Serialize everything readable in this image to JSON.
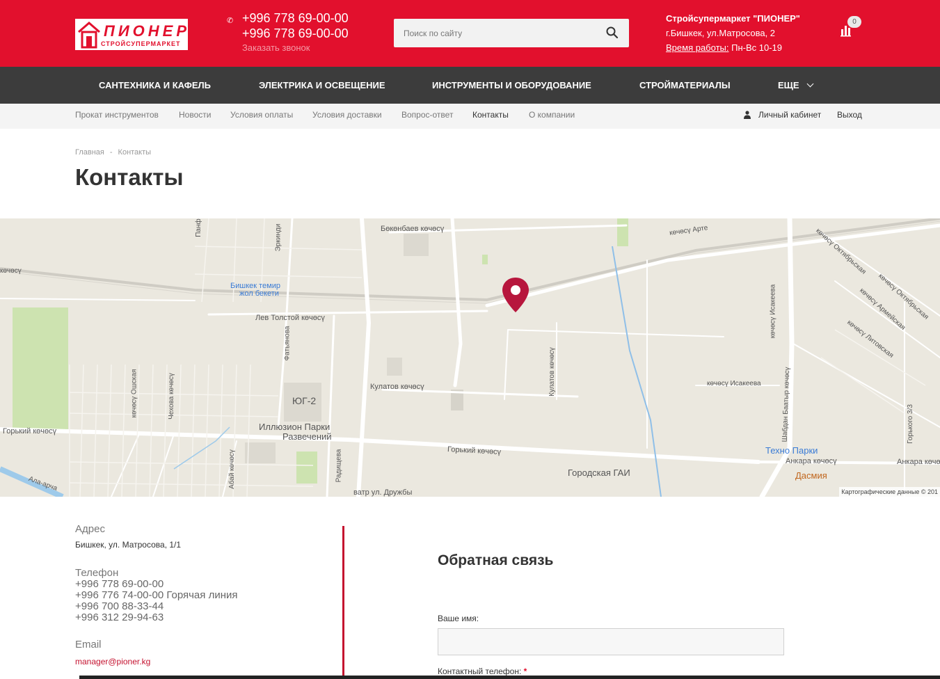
{
  "header": {
    "logo_text": "ПИОНЕР",
    "logo_sub": "СТРОЙСУПЕРМАРКЕТ",
    "phone_1": "+996 778 69-00-00",
    "phone_2": "+996 778 69-00-00",
    "callback": "Заказать звонок",
    "search_placeholder": "Поиск по сайту",
    "store_name": "Стройсупермаркет \"ПИОНЕР\"",
    "store_address": "г.Бишкек, ул.Матросова, 2",
    "hours_label": "Время работы:",
    "hours_value": " Пн-Вс 10-19",
    "compare_count": "0",
    "brand_color": "#e2102d"
  },
  "main_nav": [
    {
      "label": "САНТЕХНИКА И КАФЕЛЬ"
    },
    {
      "label": "ЭЛЕКТРИКА И ОСВЕЩЕНИЕ"
    },
    {
      "label": "ИНСТРУМЕНТЫ И ОБОРУДОВАНИЕ"
    },
    {
      "label": "СТРОЙМАТЕРИАЛЫ"
    },
    {
      "label": "ЕЩЕ"
    }
  ],
  "sub_nav": [
    {
      "label": "Прокат инструментов"
    },
    {
      "label": "Новости"
    },
    {
      "label": "Условия оплаты"
    },
    {
      "label": "Условия доставки"
    },
    {
      "label": "Вопрос-ответ"
    },
    {
      "label": "Контакты"
    },
    {
      "label": "О компании"
    }
  ],
  "account": {
    "cabinet": "Личный кабинет",
    "logout": "Выход"
  },
  "breadcrumb": {
    "home": "Главная",
    "sep": "-",
    "current": "Контакты"
  },
  "page_title": "Контакты",
  "map": {
    "labels": {
      "bekenbaev": "Бөкөнбаев көчөсү",
      "arte": "көчөсү Арте",
      "station_1": "Бишкек темир",
      "station_2": "жол бекети",
      "lev_tolstoy": "Лев Толстой көчөсү",
      "kulatov_h": "Кулатов көчөсү",
      "kulatov_v": "Кулатов көчөсү",
      "yug2": "ЮГ-2",
      "park_1": "Иллюзион Парки",
      "park_2": "Развечений",
      "gorky_left": "Горький көчөсү",
      "gorky_mid": "Горький көчөсү",
      "gai": "Городская ГАИ",
      "tekhno": "Техно Парки",
      "ankara_1": "Анкара көчөсү",
      "ankara_2": "Анкара көчөсү",
      "dasmiya": "Дасмия",
      "isakeev_h": "көчөсү Исакеева",
      "isakeev_v": "көчөсү Исакеева",
      "oktyabrskaya_1": "көчөсү Октябрьская",
      "oktyabrskaya_2": "көчөсү Октябрьская",
      "armeyskaya": "көчөсү Армейская",
      "litovskaya": "көчөсү Литовская",
      "baatyr_v": "Шабдан Баатыр көчөсү",
      "erkindik": "Эркинди",
      "fatyanova": "Фатьянова",
      "chekhova": "Чехова көчөсү",
      "oshskaya": "көчөсү Ошская",
      "abai": "Абай көчөсү",
      "radishcheva": "Радищева",
      "druzhby": "ватр ул. Дружбы",
      "ala_archa": "Ала-арча",
      "gorkogo_33": "Горького 3/3",
      "left_edge": "көчөсү",
      "panf": "Панф"
    },
    "credit": "Картографические данные © 201"
  },
  "contacts": {
    "address_label": "Адрес",
    "address_value": "Бишкек, ул. Матросова, 1/1",
    "phone_label": "Телефон",
    "phones": [
      "+996 778 69-00-00",
      "+996 776 74-00-00 Горячая линия",
      "+996 700 88-33-44",
      "+996 312 29-94-63"
    ],
    "email_label": "Email",
    "email_value": "manager@pioner.kg"
  },
  "feedback": {
    "title": "Обратная связь",
    "name_label": "Ваше имя:",
    "phone_label": "Контактный телефон:",
    "required_mark": "*"
  }
}
